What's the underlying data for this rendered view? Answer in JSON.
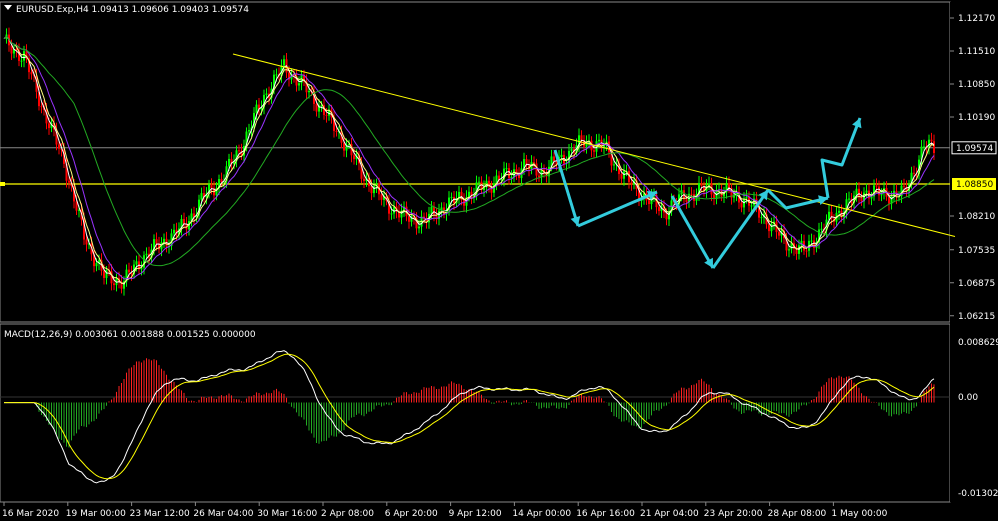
{
  "price_panel": {
    "header": "EURUSD.Exp,H4  1.09413 1.09606 1.09403 1.09574",
    "current_price": "1.09574",
    "yellow_level": "1.08850"
  },
  "macd_panel": {
    "header": "MACD(12,26,9) 0.003061 0.001888 0.001525 0.000000"
  },
  "colors": {
    "background": "#000000",
    "bull_candle": "#00ff00",
    "bear_candle": "#ff0000",
    "trendline": "#ffff00",
    "arrows": "#33ccdd",
    "ma_fast": "#ffffff",
    "ma_mid": "#ffff80",
    "ma_slow": "#9933ff",
    "ma_long": "#22aa22",
    "macd_pos": "#ff2020",
    "macd_neg": "#22aa22",
    "macd_line": "#ffffff",
    "signal_line": "#ffff00"
  },
  "chart_data": [
    {
      "type": "candlestick",
      "symbol": "EURUSD.Exp",
      "timeframe": "H4",
      "price_ticks": [
        "1.12170",
        "1.11510",
        "1.10850",
        "1.10190",
        "1.09574",
        "1.08850",
        "1.08210",
        "1.07535",
        "1.06875",
        "1.06215"
      ],
      "ylim": [
        1.0613,
        1.1245
      ],
      "time_labels": [
        "16 Mar 2020",
        "19 Mar 00:00",
        "23 Mar 12:00",
        "26 Mar 04:00",
        "30 Mar 16:00",
        "2 Apr 08:00",
        "6 Apr 20:00",
        "9 Apr 12:00",
        "14 Apr 00:00",
        "16 Apr 16:00",
        "21 Apr 04:00",
        "23 Apr 20:00",
        "28 Apr 08:00",
        "1 May 00:00"
      ],
      "close_path": [
        [
          0,
          1.1168
        ],
        [
          8,
          1.114
        ],
        [
          16,
          1.103
        ],
        [
          24,
          1.093
        ],
        [
          32,
          1.078
        ],
        [
          40,
          1.07
        ],
        [
          48,
          1.069
        ],
        [
          56,
          1.074
        ],
        [
          64,
          1.077
        ],
        [
          72,
          1.08
        ],
        [
          80,
          1.086
        ],
        [
          88,
          1.09
        ],
        [
          96,
          1.097
        ],
        [
          104,
          1.106
        ],
        [
          112,
          1.112
        ],
        [
          120,
          1.108
        ],
        [
          128,
          1.103
        ],
        [
          136,
          1.097
        ],
        [
          144,
          1.09
        ],
        [
          152,
          1.085
        ],
        [
          160,
          1.082
        ],
        [
          168,
          1.081
        ],
        [
          176,
          1.084
        ],
        [
          184,
          1.086
        ],
        [
          192,
          1.088
        ],
        [
          200,
          1.09
        ],
        [
          208,
          1.092
        ],
        [
          216,
          1.091
        ],
        [
          224,
          1.094
        ],
        [
          232,
          1.097
        ],
        [
          240,
          1.096
        ],
        [
          248,
          1.09
        ],
        [
          256,
          1.086
        ],
        [
          264,
          1.083
        ],
        [
          272,
          1.086
        ],
        [
          280,
          1.0875
        ],
        [
          288,
          1.087
        ],
        [
          296,
          1.0855
        ],
        [
          304,
          1.082
        ],
        [
          312,
          1.077
        ],
        [
          320,
          1.075
        ],
        [
          328,
          1.08
        ],
        [
          336,
          1.084
        ],
        [
          344,
          1.087
        ],
        [
          352,
          1.0865
        ],
        [
          360,
          1.0865
        ],
        [
          368,
          1.096
        ],
        [
          372,
          1.0957
        ]
      ],
      "moving_averages": [
        {
          "color_key": "ma_fast",
          "lag": 2,
          "smooth": 2
        },
        {
          "color_key": "ma_mid",
          "lag": 4,
          "smooth": 4
        },
        {
          "color_key": "ma_slow",
          "lag": 8,
          "smooth": 9
        },
        {
          "color_key": "ma_long",
          "lag": 18,
          "smooth": 28
        }
      ],
      "horizontal_lines": [
        1.09574,
        1.0885
      ],
      "trendline": {
        "from": [
          1.1145,
          "26 Mar 04:00"
        ],
        "to": [
          1.078,
          "past 1 May 00:00"
        ]
      }
    },
    {
      "type": "macd_histogram",
      "name": "MACD(12,26,9)",
      "values_printed": [
        0.003061,
        0.001888,
        0.001525,
        0.0
      ],
      "ticks": [
        "0.008629",
        "0.00",
        "-0.013023"
      ],
      "ylim": [
        -0.013023,
        0.008629
      ]
    }
  ]
}
